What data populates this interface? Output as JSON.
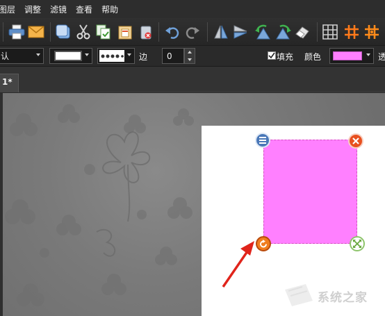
{
  "menu": {
    "items": [
      "图层",
      "调整",
      "滤镜",
      "查看",
      "帮助"
    ]
  },
  "toolbar": {
    "buttons": [
      "print-icon",
      "mail-icon",
      "layer-icon",
      "cut-icon",
      "copy-icon",
      "paste-icon",
      "delete-icon",
      "undo-icon",
      "redo-icon",
      "flip-vertical-icon",
      "flip-horizontal-icon",
      "rotate-left-icon",
      "rotate-right-icon",
      "eraser-icon",
      "grid-icon",
      "grid-orange-icon",
      "grid-orange-alt-icon"
    ]
  },
  "propbar": {
    "style_value": "认",
    "edge_label": "边",
    "edge_value": "0",
    "fill_label": "填充",
    "fill_checked": true,
    "color_label": "颜色",
    "fill_color": "#ff80ff",
    "transparency_label": "透"
  },
  "tab": {
    "label": "1*"
  },
  "canvas": {
    "shape_color": "#ff80ff",
    "handles": [
      "menu-handle-icon",
      "close-handle-icon",
      "rotate-handle-icon",
      "resize-handle-icon"
    ]
  },
  "watermark": {
    "text": "系统之家"
  }
}
